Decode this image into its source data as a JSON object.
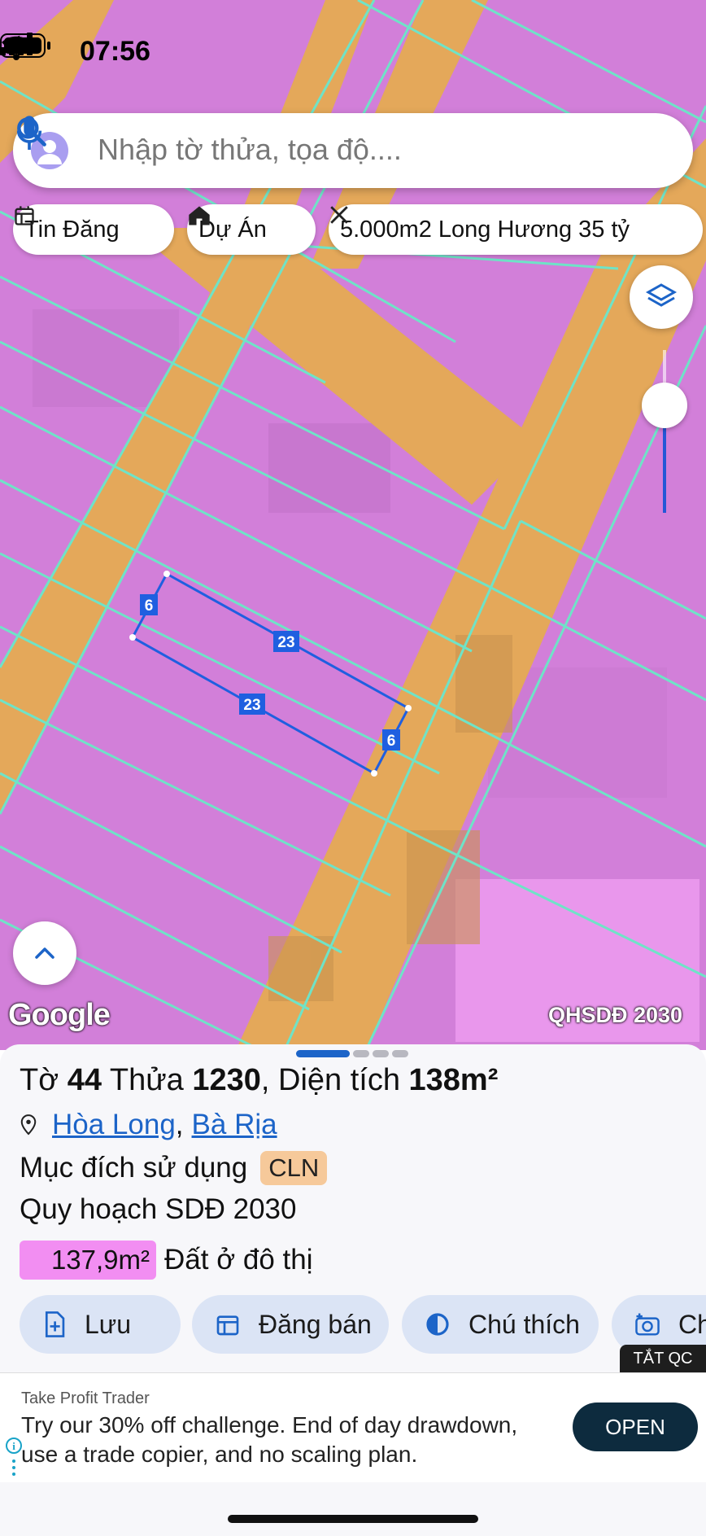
{
  "status_bar": {
    "time": "07:56"
  },
  "search": {
    "placeholder": "Nhập tờ thửa, tọa độ...."
  },
  "chips": [
    {
      "label": "Tin Đăng",
      "icon": "calendar-icon"
    },
    {
      "label": "Dự Án",
      "icon": "house-icon"
    },
    {
      "label": "5.000m2 Long Hương 35 tỷ",
      "icon": "ruler-icon"
    }
  ],
  "map": {
    "google_logo": "Google",
    "layer_label": "QHSDĐ 2030",
    "parcel_dimensions": {
      "top": "23",
      "bottom": "23",
      "left": "6",
      "right": "6"
    },
    "colors": {
      "residential": "#d27fd9",
      "road": "#e4a85a",
      "boundary": "#6fe3c7",
      "selection": "#1f5fe0"
    }
  },
  "parcel": {
    "to_label": "Tờ",
    "to_number": "44",
    "thua_label": "Thửa",
    "thua_number": "1230",
    "dien_tich_label": ", Diện tích",
    "area": "138m²",
    "ward": "Hòa Long",
    "city": "Bà Rịa",
    "purpose_label": "Mục đích sử dụng",
    "purpose_code": "CLN",
    "plan_label": "Quy hoạch SDĐ 2030",
    "plan_area": "137,9m²",
    "plan_use": "Đất ở đô thị"
  },
  "actions": [
    {
      "label": "Lưu",
      "icon": "save-doc-icon"
    },
    {
      "label": "Đăng bán",
      "icon": "calendar-icon"
    },
    {
      "label": "Chú thích",
      "icon": "contrast-icon"
    },
    {
      "label": "Ch",
      "icon": "camera-icon"
    }
  ],
  "ad": {
    "close_label": "TẮT QC",
    "advertiser": "Take Profit Trader",
    "text": "Try our 30% off challenge. End of day drawdown, use a trade copier, and no scaling plan.",
    "button": "OPEN"
  }
}
